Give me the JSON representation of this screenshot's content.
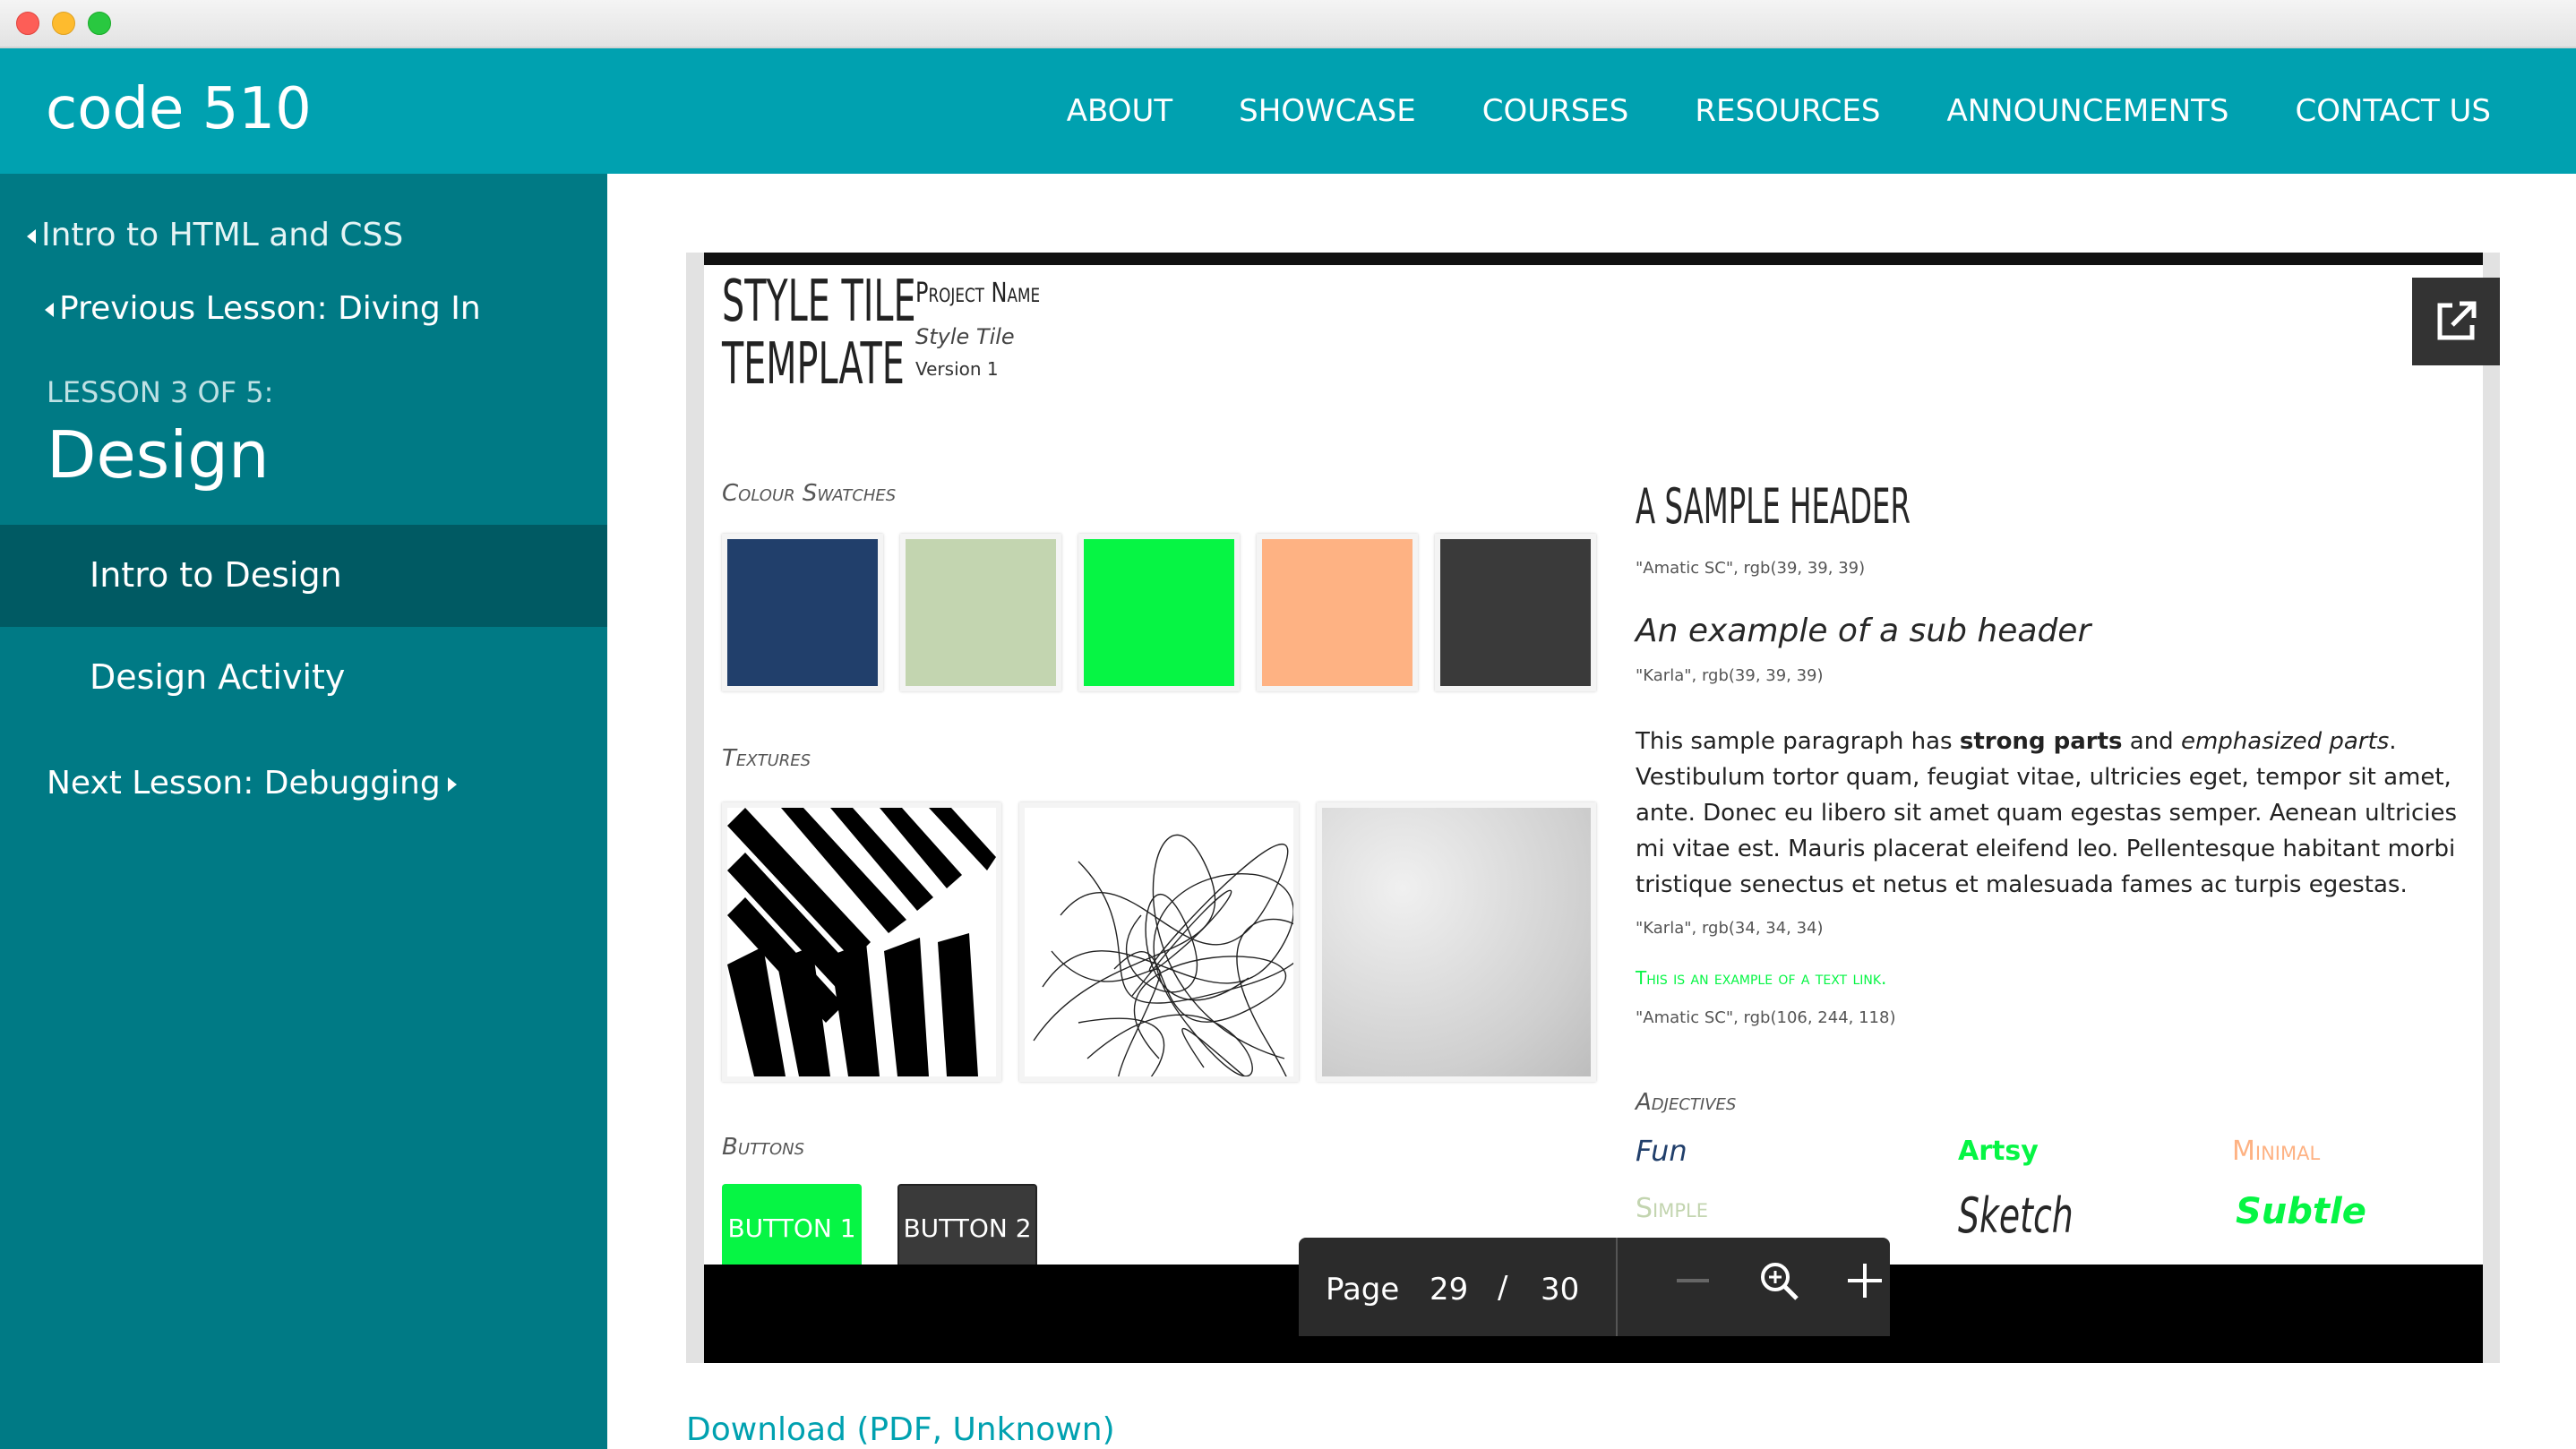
{
  "header": {
    "logo": "code 510",
    "nav": [
      "ABOUT",
      "SHOWCASE",
      "COURSES",
      "RESOURCES",
      "ANNOUNCEMENTS",
      "CONTACT US"
    ]
  },
  "sidebar": {
    "course_link": "Intro to HTML and CSS",
    "prev_lesson": "Previous Lesson: Diving In",
    "lesson_counter": "LESSON 3 OF 5:",
    "lesson_title": "Design",
    "items": [
      "Intro to Design",
      "Design Activity"
    ],
    "next_lesson": "Next Lesson: Debugging"
  },
  "style_tile": {
    "title": "STYLE TILE\nTEMPLATE",
    "project_name": "Project Name",
    "tile_label": "Style Tile",
    "version": "Version 1",
    "swatches_label": "Colour Swatches",
    "swatches": [
      "#213f6b",
      "#c3d5b0",
      "#06f544",
      "#feb283",
      "#3a3a3a"
    ],
    "textures_label": "Textures",
    "buttons_label": "Buttons",
    "button1": "BUTTON 1",
    "button2": "BUTTON 2",
    "sample_header": "A SAMPLE HEADER",
    "header_font": "\"Amatic SC\", rgb(39, 39, 39)",
    "sub_header": "An example of a sub header",
    "sub_font": "\"Karla\", rgb(39, 39, 39)",
    "para_pre": "This sample paragraph has ",
    "para_strong": "strong parts",
    "para_mid": " and ",
    "para_em": "emphasized parts",
    "para_post": ". Vestibulum tortor quam, feugiat vitae, ultricies eget, tempor sit amet, ante. Donec eu libero sit amet quam egestas semper. Aenean ultricies mi vitae est. Mauris placerat eleifend leo. Pellentesque habitant morbi tristique senectus et netus et malesuada fames ac turpis egestas.",
    "para_font": "\"Karla\", rgb(34, 34, 34)",
    "text_link": "This is an example of a text link.",
    "link_font": "\"Amatic SC\", rgb(106, 244, 118)",
    "adjectives_label": "Adjectives",
    "adjectives": [
      "Fun",
      "Artsy",
      "Minimal",
      "Simple",
      "Sketch",
      "Subtle"
    ]
  },
  "viewer": {
    "page_label": "Page",
    "page_current": "29",
    "page_sep": "/",
    "page_total": "30"
  },
  "download": "Download (PDF, Unknown)"
}
